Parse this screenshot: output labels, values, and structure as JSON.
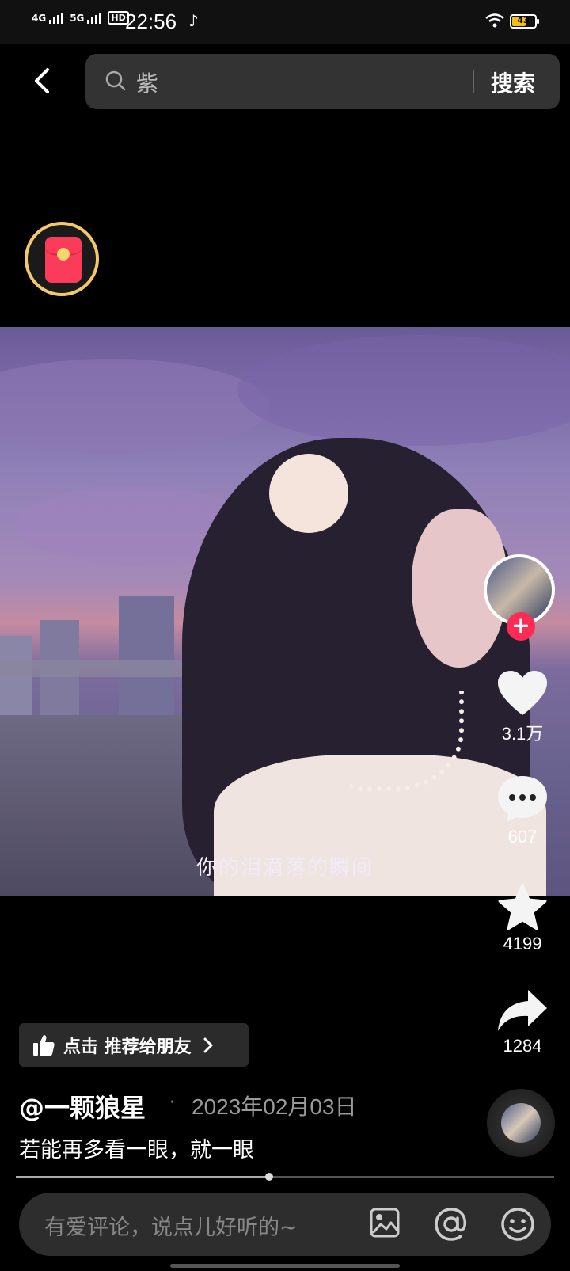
{
  "status_bar": {
    "net1": "4G",
    "net2": "5G",
    "hd": "HD",
    "time": "22:56",
    "battery": "43"
  },
  "search": {
    "query": "紫",
    "button": "搜索"
  },
  "video": {
    "subtitle": "你的泪滴落的瞬间"
  },
  "actions": {
    "likes": "3.1万",
    "comments": "607",
    "favorites": "4199",
    "shares": "1284"
  },
  "recommend": {
    "label": "点击 推荐给朋友"
  },
  "post": {
    "author": "@一颗狼星",
    "separator": "·",
    "date": "2023年02月03日",
    "caption": "若能再多看一眼，就一眼",
    "progress": 0.47
  },
  "comment": {
    "placeholder": "有爱评论，说点儿好听的~"
  },
  "colors": {
    "accent": "#fe2c55",
    "redpacket_ring": "#f5c86a"
  },
  "icons": [
    "back-icon",
    "search-icon",
    "red-packet-icon",
    "heart-icon",
    "comment-icon",
    "star-icon",
    "share-icon",
    "thumbs-up-icon",
    "chevron-right-icon",
    "image-icon",
    "at-icon",
    "emoji-icon"
  ]
}
